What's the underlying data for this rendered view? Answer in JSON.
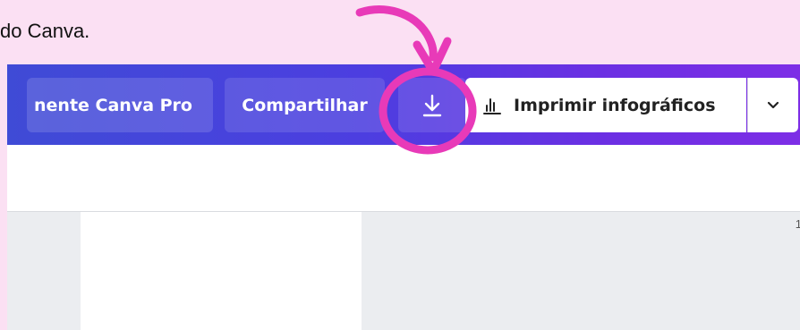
{
  "caption": "do Canva.",
  "toolbar": {
    "pro_label": "nente Canva Pro",
    "share_label": "Compartilhar",
    "download_icon": "download-icon",
    "print_icon": "bar-chart-icon",
    "print_label": "Imprimir infográficos",
    "more_icon": "chevron-down-icon"
  },
  "canvas": {
    "ruler_number": "1"
  },
  "colors": {
    "highlight": "#e83ab8",
    "toolbar_start": "#3f4bd6",
    "toolbar_end": "#7d2ee6",
    "background": "#fbe0f3"
  }
}
